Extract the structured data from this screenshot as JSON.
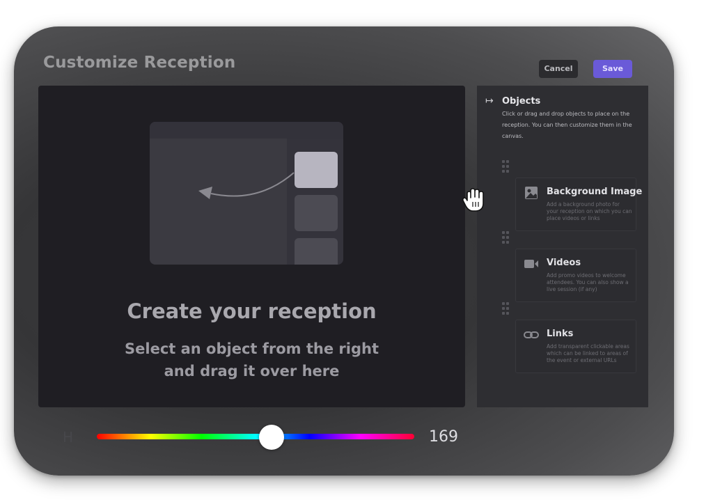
{
  "dialog": {
    "title": "Customize Reception",
    "cancel_label": "Cancel",
    "save_label": "Save",
    "colors": {
      "save": "#6a5ad8",
      "cancel": "#2b2b2e"
    }
  },
  "canvas": {
    "headline": "Create your reception",
    "subline_1": "Select an object from the right",
    "subline_2": "and drag it over here"
  },
  "objects_panel": {
    "title": "Objects",
    "description": "Click or drag and drop objects to place on the reception. You can then customize them in the canvas.",
    "items": [
      {
        "name": "Background Image",
        "icon": "image-icon",
        "description": "Add a background photo for your reception on which you can place videos or links"
      },
      {
        "name": "Videos",
        "icon": "video-camera-icon",
        "description": "Add promo videos to welcome attendees. You can also show a live session (if any)"
      },
      {
        "name": "Links",
        "icon": "link-icon",
        "description": "Add transparent clickable areas which can be linked to areas of the event or external URLs"
      }
    ]
  },
  "hue_slider": {
    "label": "H",
    "value": "169",
    "fraction": 0.55
  }
}
